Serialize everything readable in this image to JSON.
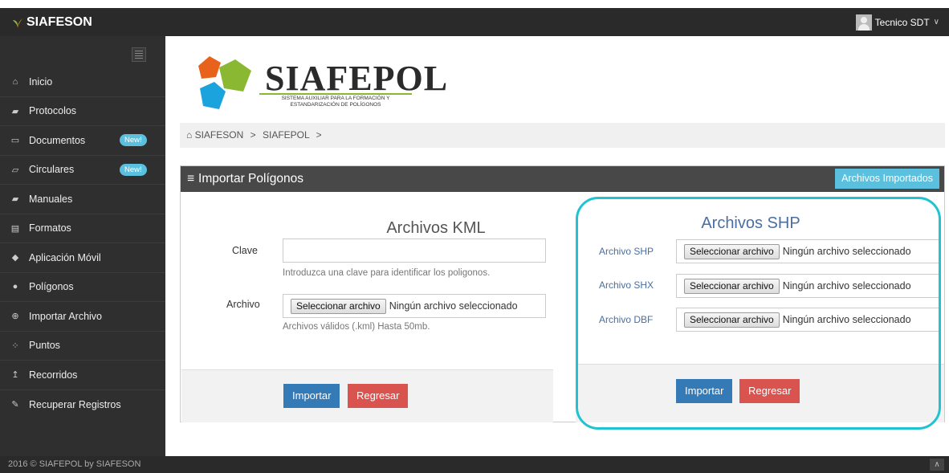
{
  "app": {
    "brand": "SIAFESON"
  },
  "user": {
    "name": "Tecnico SDT"
  },
  "sidebar": {
    "items": [
      {
        "label": "Inicio",
        "icon": "home-icon",
        "glyph": "⌂"
      },
      {
        "label": "Protocolos",
        "icon": "book-icon",
        "glyph": "▰"
      },
      {
        "label": "Documentos",
        "icon": "folder-icon",
        "glyph": "▭",
        "badge": "New!"
      },
      {
        "label": "Circulares",
        "icon": "folder-open-icon",
        "glyph": "▱",
        "badge": "New!"
      },
      {
        "label": "Manuales",
        "icon": "book-icon",
        "glyph": "▰"
      },
      {
        "label": "Formatos",
        "icon": "file-icon",
        "glyph": "▤"
      },
      {
        "label": "Aplicación Móvil",
        "icon": "android-icon",
        "glyph": "◆"
      },
      {
        "label": "Polígonos",
        "icon": "circle-icon",
        "glyph": "●"
      },
      {
        "label": "Importar Archivo",
        "icon": "plus-circle-icon",
        "glyph": "⊕"
      },
      {
        "label": "Puntos",
        "icon": "spinner-icon",
        "glyph": "⁘"
      },
      {
        "label": "Recorridos",
        "icon": "level-up-icon",
        "glyph": "↥"
      },
      {
        "label": "Recuperar Registros",
        "icon": "wrench-icon",
        "glyph": "✎"
      }
    ]
  },
  "logo": {
    "title": "SIAFEPOL",
    "subtitle_line1": "SISTEMA AUXILIAR PARA LA FORMACIÓN Y",
    "subtitle_line2": "ESTANDARIZACIÓN DE POLÍGONOS"
  },
  "breadcrumb": {
    "items": [
      "SIAFESON",
      "SIAFEPOL"
    ],
    "separator": ">"
  },
  "panel": {
    "title": "Importar Polígonos",
    "imported_button": "Archivos Importados"
  },
  "kml": {
    "title": "Archivos KML",
    "clave_label": "Clave",
    "clave_value": "",
    "clave_help": "Introduzca una clave para identificar los poligonos.",
    "archivo_label": "Archivo",
    "file_button": "Seleccionar archivo",
    "file_status": "Ningún archivo seleccionado",
    "archivo_help": "Archivos válidos (.kml) Hasta 50mb.",
    "import_button": "Importar",
    "back_button": "Regresar"
  },
  "shp": {
    "title": "Archivos SHP",
    "files": [
      {
        "label": "Archivo SHP",
        "button": "Seleccionar archivo",
        "status": "Ningún archivo seleccionado"
      },
      {
        "label": "Archivo SHX",
        "button": "Seleccionar archivo",
        "status": "Ningún archivo seleccionado"
      },
      {
        "label": "Archivo DBF",
        "button": "Seleccionar archivo",
        "status": "Ningún archivo seleccionado"
      }
    ],
    "import_button": "Importar",
    "back_button": "Regresar"
  },
  "footer": {
    "text": "2016 © SIAFEPOL by SIAFESON"
  },
  "colors": {
    "accent": "#5bc0de",
    "primary": "#337ab7",
    "danger": "#d9534f",
    "highlight": "#22c3d0",
    "dark": "#2f2f2f"
  }
}
